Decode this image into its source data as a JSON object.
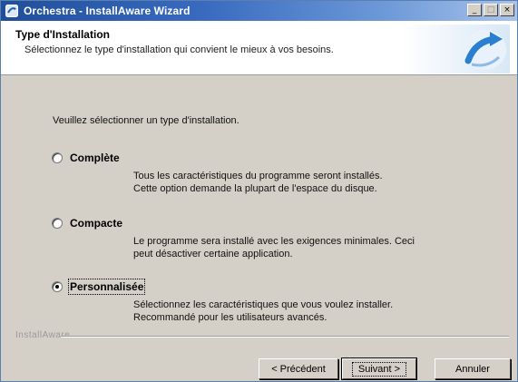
{
  "window": {
    "title": "Orchestra - InstallAware Wizard",
    "controls": {
      "minimize_glyph": "_",
      "maximize_glyph": "□",
      "close_glyph": "×"
    },
    "icon": "installer-app-icon"
  },
  "header": {
    "title": "Type d'Installation",
    "subtitle": "Sélectionnez le type d'installation qui convient le mieux à vos besoins.",
    "logo": "installaware-swoosh-logo"
  },
  "body": {
    "prompt": "Veuillez sélectionner un type d'installation.",
    "options": [
      {
        "label": "Complète",
        "selected": false,
        "desc_line1": "Tous les caractéristiques du programme seront installés.",
        "desc_line2": "Cette option demande la plupart de l'espace du disque."
      },
      {
        "label": "Compacte",
        "selected": false,
        "desc_line1": "Le programme sera installé avec les exigences minimales. Ceci",
        "desc_line2": "peut désactiver certaine application."
      },
      {
        "label": "Personnalisée",
        "selected": true,
        "desc_line1": "Sélectionnez les caractéristiques que vous voulez installer.",
        "desc_line2": "Recommandé pour les utilisateurs avancés."
      }
    ]
  },
  "footer": {
    "brand": "InstallAware",
    "back_label": "< Précédent",
    "next_label": "Suivant >",
    "cancel_label": "Annuler"
  },
  "colors": {
    "titlebar_start": "#1f4f9a",
    "titlebar_end": "#a9c3ea",
    "dialog_face": "#d4d0c8",
    "logo_blue": "#2b7fd0"
  }
}
